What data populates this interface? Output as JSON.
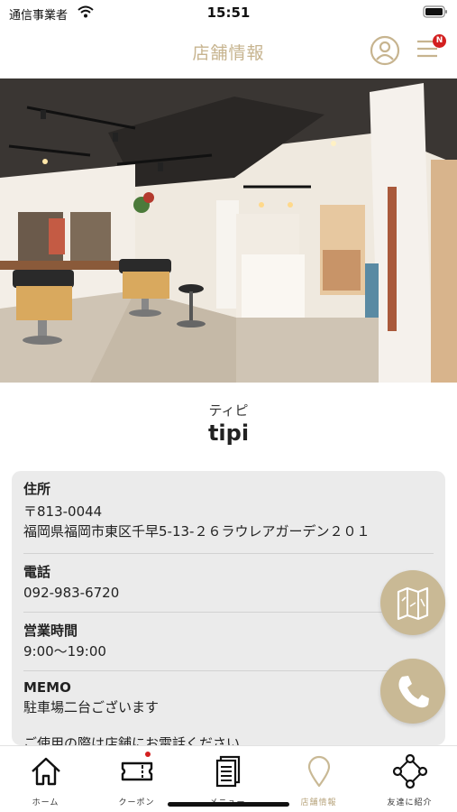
{
  "status_bar": {
    "carrier": "通信事業者",
    "time": "15:51"
  },
  "header": {
    "title": "店舗情報",
    "notification_badge": "N"
  },
  "salon": {
    "name_kana": "ティピ",
    "name": "tipi"
  },
  "info": {
    "address": {
      "label": "住所",
      "postal_code": "〒813-0044",
      "line": "福岡県福岡市東区千早5-13-２６ラウレアガーデン２０１"
    },
    "phone": {
      "label": "電話",
      "value": "092-983-6720"
    },
    "hours": {
      "label": "営業時間",
      "value": "9:00〜19:00"
    },
    "memo": {
      "label": "MEMO",
      "value": "駐車場二台ございます",
      "extra": "ご使用の際は店舗にお電話ください"
    }
  },
  "tabs": [
    {
      "label": "ホーム",
      "icon": "home-icon"
    },
    {
      "label": "クーポン",
      "icon": "ticket-icon"
    },
    {
      "label": "メニュー",
      "icon": "document-icon"
    },
    {
      "label": "店舗情報",
      "icon": "map-pin-icon",
      "active": true
    },
    {
      "label": "友達に紹介",
      "icon": "share-icon"
    }
  ],
  "colors": {
    "accent": "#c9b995",
    "accent_text": "#c7b48f",
    "badge": "#d32020"
  }
}
